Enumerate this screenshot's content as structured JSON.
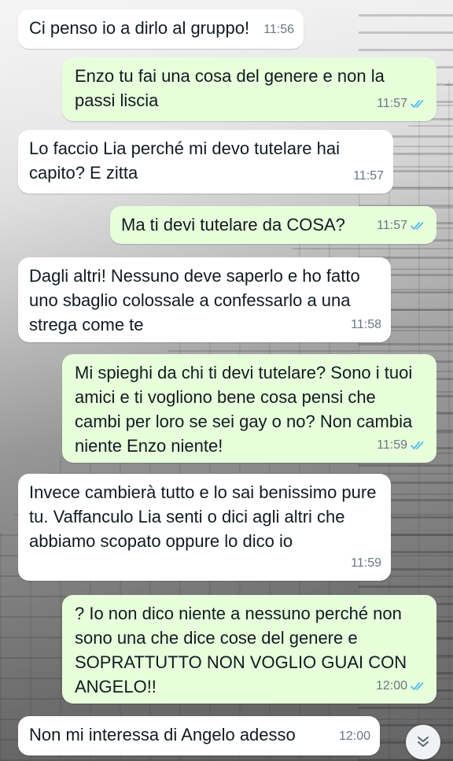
{
  "messages": [
    {
      "direction": "incoming",
      "text": "Ci penso io a dirlo al gruppo!",
      "time": "11:56"
    },
    {
      "direction": "outgoing",
      "text": "Enzo tu fai una cosa del genere e non la passi liscia",
      "time": "11:57",
      "status": "read"
    },
    {
      "direction": "incoming",
      "text": "Lo faccio Lia perché mi devo tutelare hai capito? E zitta",
      "time": "11:57"
    },
    {
      "direction": "outgoing",
      "text": "Ma ti devi tutelare da COSA?",
      "time": "11:57",
      "status": "read"
    },
    {
      "direction": "incoming",
      "text": "Dagli altri! Nessuno deve saperlo e ho fatto uno sbaglio colossale a confessarlo a una strega come te",
      "time": "11:58"
    },
    {
      "direction": "outgoing",
      "text": "Mi spieghi da chi ti devi tutelare? Sono i tuoi amici e ti vogliono bene cosa pensi che cambi per loro se sei gay o no? Non cambia niente Enzo niente!",
      "time": "11:59",
      "status": "read"
    },
    {
      "direction": "incoming",
      "text": "Invece cambierà tutto e lo sai benissimo pure tu. Vaffanculo Lia senti o dici agli altri che abbiamo scopato oppure lo dico io",
      "time": "11:59"
    },
    {
      "direction": "outgoing",
      "text": "? Io non dico niente a nessuno perché non sono una che dice cose del genere e SOPRATTUTTO NON VOGLIO GUAI CON ANGELO!!",
      "time": "12:00",
      "status": "read"
    },
    {
      "direction": "incoming",
      "text": "Non mi interessa di Angelo adesso",
      "time": "12:00"
    }
  ],
  "colors": {
    "incoming_bubble": "#ffffff",
    "outgoing_bubble": "#e7ffdb",
    "read_ticks": "#53bdeb",
    "meta_text": "#667781"
  },
  "icons": {
    "read_status": "double-check-icon",
    "scroll_down": "double-chevron-down-icon"
  }
}
